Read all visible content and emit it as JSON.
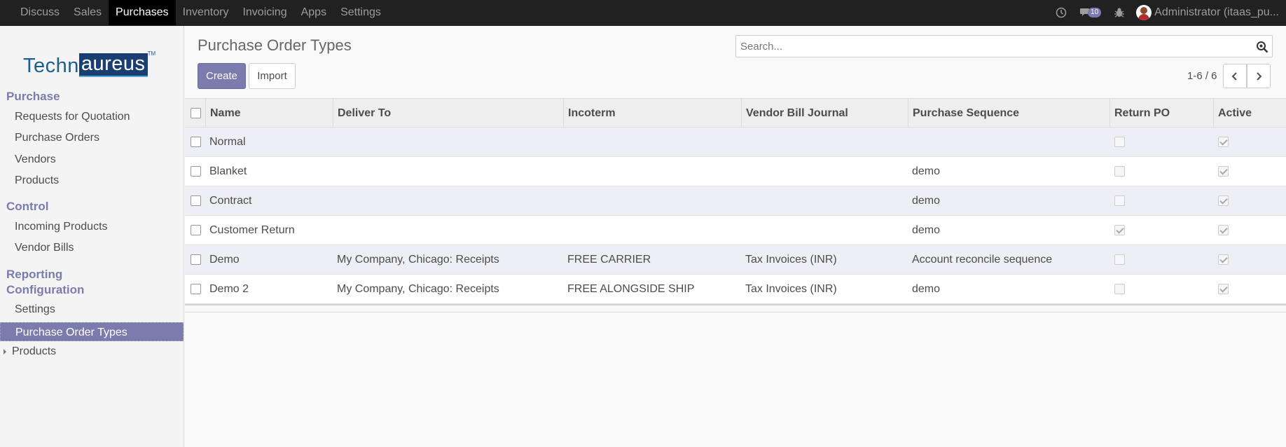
{
  "menu": [
    "Discuss",
    "Sales",
    "Purchases",
    "Inventory",
    "Invoicing",
    "Apps",
    "Settings"
  ],
  "menu_active": "Purchases",
  "systray": {
    "messages_count": "10",
    "user": "Administrator (itaas_pu..."
  },
  "logo": {
    "part1": "Techn",
    "part2": "aureus",
    "tm": "TM"
  },
  "sidebar": {
    "purchase": "Purchase",
    "requests": "Requests for Quotation",
    "orders": "Purchase Orders",
    "vendors": "Vendors",
    "products": "Products",
    "control": "Control",
    "incoming": "Incoming Products",
    "bills": "Vendor Bills",
    "reporting": "Reporting",
    "configuration": "Configuration",
    "settings": "Settings",
    "po_types": "Purchase Order Types",
    "products2": "Products"
  },
  "page": {
    "title": "Purchase Order Types",
    "create": "Create",
    "import": "Import",
    "search_placeholder": "Search...",
    "pager": "1-6 / 6"
  },
  "columns": [
    "Name",
    "Deliver To",
    "Incoterm",
    "Vendor Bill Journal",
    "Purchase Sequence",
    "Return PO",
    "Active"
  ],
  "rows": [
    {
      "name": "Normal",
      "deliver_to": "",
      "incoterm": "",
      "journal": "",
      "sequence": "",
      "return_po": false,
      "active": true
    },
    {
      "name": "Blanket",
      "deliver_to": "",
      "incoterm": "",
      "journal": "",
      "sequence": "demo",
      "return_po": false,
      "active": true
    },
    {
      "name": "Contract",
      "deliver_to": "",
      "incoterm": "",
      "journal": "",
      "sequence": "demo",
      "return_po": false,
      "active": true
    },
    {
      "name": "Customer Return",
      "deliver_to": "",
      "incoterm": "",
      "journal": "",
      "sequence": "demo",
      "return_po": true,
      "active": true
    },
    {
      "name": "Demo",
      "deliver_to": "My Company, Chicago: Receipts",
      "incoterm": "FREE CARRIER",
      "journal": "Tax Invoices (INR)",
      "sequence": "Account reconcile sequence",
      "return_po": false,
      "active": true
    },
    {
      "name": "Demo 2",
      "deliver_to": "My Company, Chicago: Receipts",
      "incoterm": "FREE ALONGSIDE SHIP",
      "journal": "Tax Invoices (INR)",
      "sequence": "demo",
      "return_po": false,
      "active": true
    }
  ],
  "colors": {
    "topbar": "#212121",
    "accent": "#7c7bad",
    "sidebar": "#f4f4f4"
  }
}
